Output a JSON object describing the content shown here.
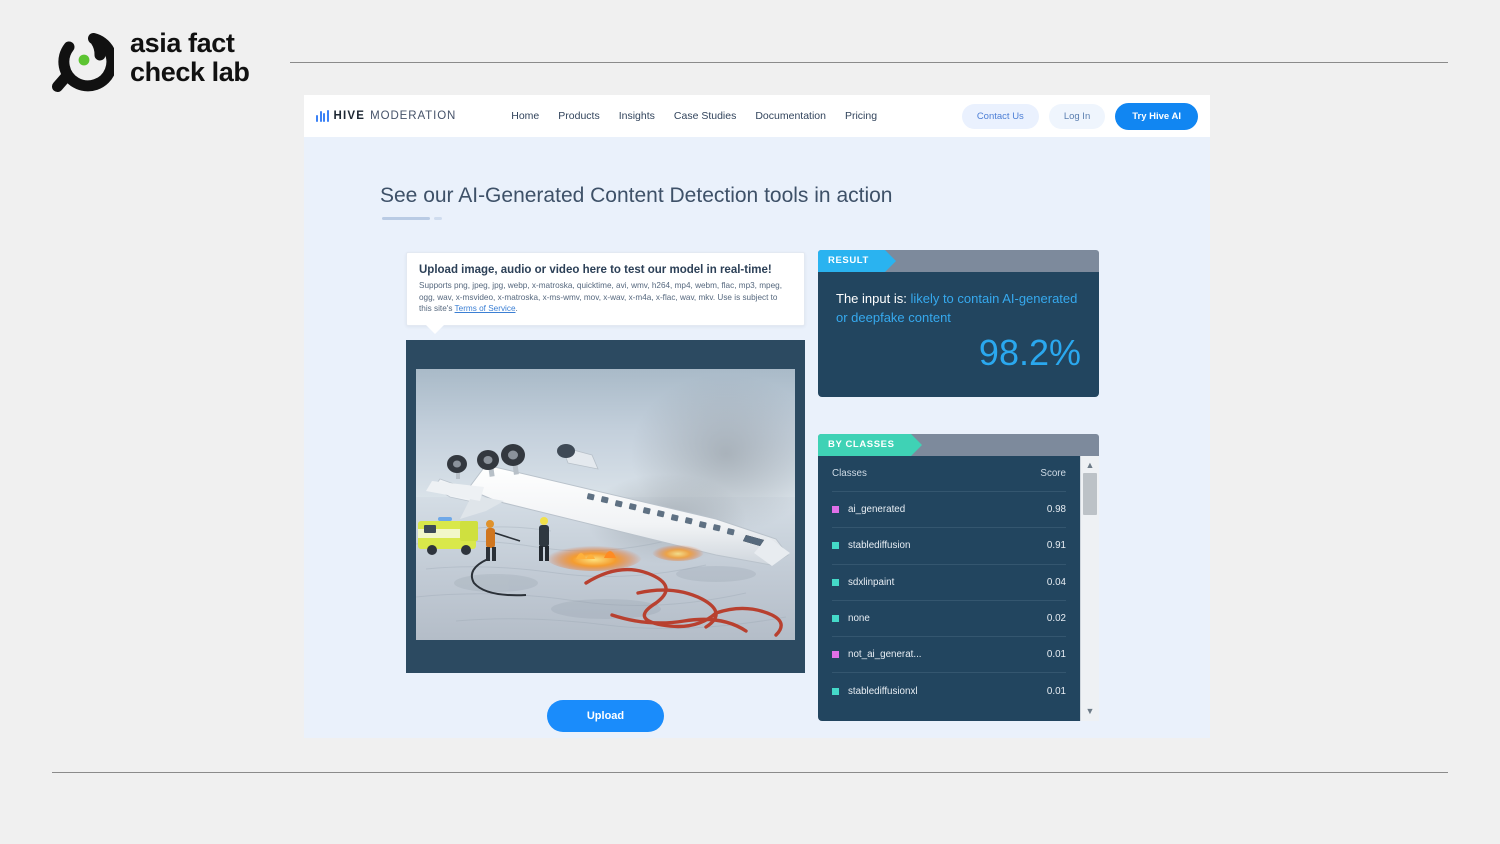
{
  "brand": {
    "name_line1": "asia fact",
    "name_line2": "check lab",
    "dot_color": "#5cc431"
  },
  "site": {
    "logo_text_bold": "HIVE",
    "logo_text_light": "MODERATION",
    "nav_links": [
      "Home",
      "Products",
      "Insights",
      "Case Studies",
      "Documentation",
      "Pricing"
    ],
    "actions": {
      "contact": "Contact Us",
      "login": "Log In",
      "try": "Try Hive AI"
    }
  },
  "page": {
    "title": "See our AI-Generated Content Detection tools in action"
  },
  "upload": {
    "tip_title": "Upload image, audio or video here to test our model in real-time!",
    "tip_body_part1": "Supports png, jpeg, jpg, webp, x-matroska, quicktime, avi, wmv, h264, mp4, webm, flac, mp3, mpeg, ogg, wav, x-msvideo, x-matroska, x-ms-wmv, mov, x-wav, x-m4a, x-flac, wav, mkv. Use is subject to this site's ",
    "tos_link": "Terms of Service",
    "tip_body_part2": ".",
    "button_label": "Upload",
    "image_alt": "Overturned white regional jet aircraft on a snowy runway with firefighters, flames, an ambulance and a red hose"
  },
  "result": {
    "tab_label": "RESULT",
    "prefix": "The input is: ",
    "verdict": "likely to contain AI-generated or deepfake content",
    "score": "98.2%"
  },
  "classes": {
    "tab_label": "BY CLASSES",
    "header": {
      "name": "Classes",
      "score": "Score"
    },
    "rows": [
      {
        "name": "ai_generated",
        "score": "0.98",
        "color": "#e070e8",
        "swatch": "pink"
      },
      {
        "name": "stablediffusion",
        "score": "0.91",
        "color": "#44d9c8",
        "swatch": "teal"
      },
      {
        "name": "sdxlinpaint",
        "score": "0.04",
        "color": "#44d9c8",
        "swatch": "teal"
      },
      {
        "name": "none",
        "score": "0.02",
        "color": "#44d9c8",
        "swatch": "teal"
      },
      {
        "name": "not_ai_generat...",
        "score": "0.01",
        "color": "#e070e8",
        "swatch": "pink"
      },
      {
        "name": "stablediffusionxl",
        "score": "0.01",
        "color": "#44d9c8",
        "swatch": "teal"
      }
    ],
    "scroll_up": "▲",
    "scroll_down": "▼"
  },
  "colors": {
    "accent_blue": "#1186f2",
    "result_cyan": "#2ab3f0",
    "classes_teal": "#3fd2b5",
    "panel_dark": "#22455f",
    "panel_head": "#7d8a9c",
    "page_bg": "#eaf1fb"
  }
}
